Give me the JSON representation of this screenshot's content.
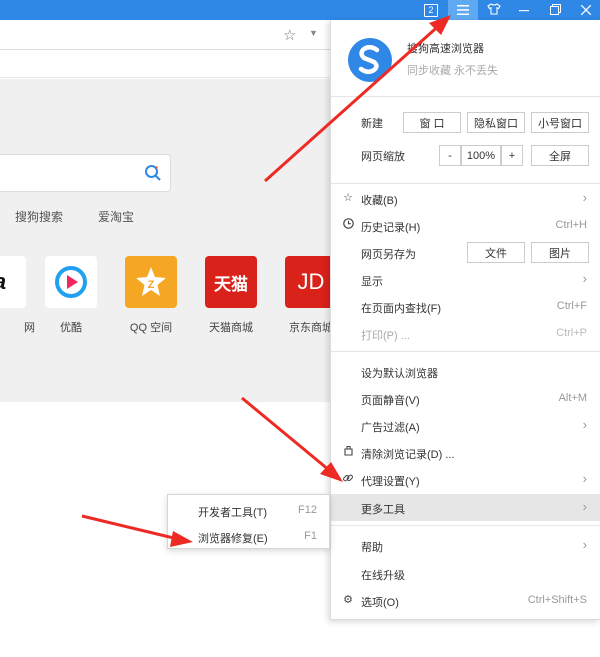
{
  "titlebar": {
    "tab_count": "2",
    "menu_icon": "hamburger-icon",
    "skin_icon": "shirt-icon",
    "min_icon": "minimize-icon",
    "restore_icon": "restore-icon",
    "close_icon": "close-icon"
  },
  "colors": {
    "titlebar": "#2f87e6",
    "active_button": "#5ea9f2",
    "arrow": "#ee2a24",
    "highlight": "#e6e6e6"
  },
  "page": {
    "quick_links": [
      "搜狗搜索",
      "爱淘宝"
    ],
    "sites": [
      {
        "label": "网",
        "logo_text": "a",
        "color": "#ffffff"
      },
      {
        "label": "优酷",
        "logo_text": "",
        "color": "#ffffff"
      },
      {
        "label": "QQ 空间",
        "logo_text": "Z",
        "color": "#f5a623"
      },
      {
        "label": "天猫商城",
        "logo_text": "天猫",
        "color": "#d9221a"
      },
      {
        "label": "京东商城",
        "logo_text": "JD",
        "color": "#d9221a"
      }
    ]
  },
  "menu": {
    "brand_name": "搜狗高速浏览器",
    "brand_sub": "同步收藏 永不丢失",
    "new_label": "新建",
    "new_window": "窗 口",
    "new_private": "隐私窗口",
    "new_small": "小号窗口",
    "zoom_label": "网页缩放",
    "zoom_minus": "-",
    "zoom_value": "100%",
    "zoom_plus": "+",
    "fullscreen": "全屏",
    "favorites": "收藏(B)",
    "history": "历史记录(H)",
    "history_sc": "Ctrl+H",
    "save_as": "网页另存为",
    "save_file": "文件",
    "save_image": "图片",
    "display": "显示",
    "find": "在页面内查找(F)",
    "find_sc": "Ctrl+F",
    "print": "打印(P) ...",
    "print_sc": "Ctrl+P",
    "default_browser": "设为默认浏览器",
    "mute": "页面静音(V)",
    "mute_sc": "Alt+M",
    "adblock": "广告过滤(A)",
    "clear": "清除浏览记录(D) ...",
    "proxy": "代理设置(Y)",
    "more_tools": "更多工具",
    "help": "帮助",
    "upgrade": "在线升级",
    "options": "选项(O)",
    "options_sc": "Ctrl+Shift+S"
  },
  "submenu": {
    "devtools": "开发者工具(T)",
    "devtools_sc": "F12",
    "repair": "浏览器修复(E)",
    "repair_sc": "F1"
  }
}
